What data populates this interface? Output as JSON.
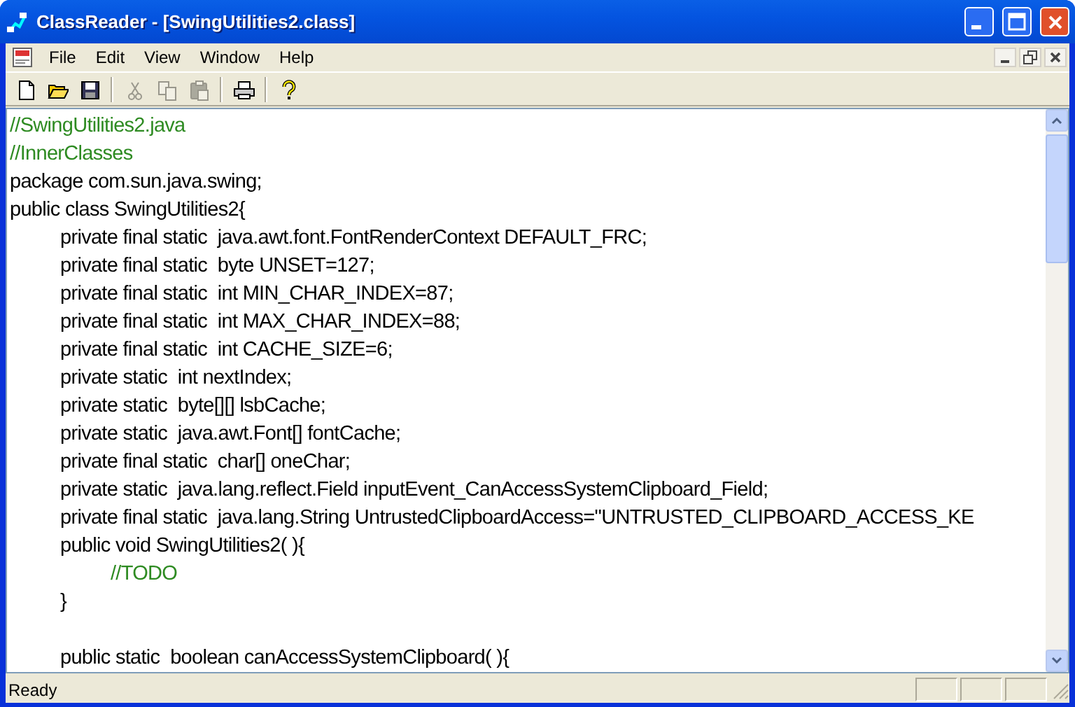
{
  "window": {
    "title": "ClassReader - [SwingUtilities2.class]"
  },
  "menu": [
    {
      "label": "File"
    },
    {
      "label": "Edit"
    },
    {
      "label": "View"
    },
    {
      "label": "Window"
    },
    {
      "label": "Help"
    }
  ],
  "toolbar": [
    {
      "kind": "new",
      "disabled": false
    },
    {
      "kind": "open",
      "disabled": false
    },
    {
      "kind": "save",
      "disabled": false
    },
    {
      "kind": "separator"
    },
    {
      "kind": "cut",
      "disabled": true
    },
    {
      "kind": "copy",
      "disabled": true
    },
    {
      "kind": "paste",
      "disabled": true
    },
    {
      "kind": "separator"
    },
    {
      "kind": "print",
      "disabled": false
    },
    {
      "kind": "separator"
    },
    {
      "kind": "help",
      "disabled": false
    }
  ],
  "code": [
    {
      "kind": "comment",
      "text": "//SwingUtilities2.java"
    },
    {
      "kind": "comment",
      "text": "//InnerClasses"
    },
    {
      "kind": "code",
      "text": "package com.sun.java.swing;"
    },
    {
      "kind": "code",
      "text": "public class SwingUtilities2{",
      "children": [
        {
          "kind": "code",
          "text": "private final static  java.awt.font.FontRenderContext DEFAULT_FRC;"
        },
        {
          "kind": "code",
          "text": "private final static  byte UNSET=127;"
        },
        {
          "kind": "code",
          "text": "private final static  int MIN_CHAR_INDEX=87;"
        },
        {
          "kind": "code",
          "text": "private final static  int MAX_CHAR_INDEX=88;"
        },
        {
          "kind": "code",
          "text": "private final static  int CACHE_SIZE=6;"
        },
        {
          "kind": "code",
          "text": "private static  int nextIndex;"
        },
        {
          "kind": "code",
          "text": "private static  byte[][] lsbCache;"
        },
        {
          "kind": "code",
          "text": "private static  java.awt.Font[] fontCache;"
        },
        {
          "kind": "code",
          "text": "private final static  char[] oneChar;"
        },
        {
          "kind": "code",
          "text": "private static  java.lang.reflect.Field inputEvent_CanAccessSystemClipboard_Field;"
        },
        {
          "kind": "code",
          "text": "private final static  java.lang.String UntrustedClipboardAccess=\"UNTRUSTED_CLIPBOARD_ACCESS_KE"
        },
        {
          "kind": "code",
          "text": "public void SwingUtilities2( ){",
          "children": [
            {
              "kind": "comment",
              "text": "//TODO"
            }
          ]
        },
        {
          "kind": "code",
          "text": "}"
        },
        {
          "kind": "blank"
        },
        {
          "kind": "code",
          "text": "public static  boolean canAccessSystemClipboard( ){"
        }
      ]
    }
  ],
  "status_bar": {
    "text": "Ready"
  }
}
